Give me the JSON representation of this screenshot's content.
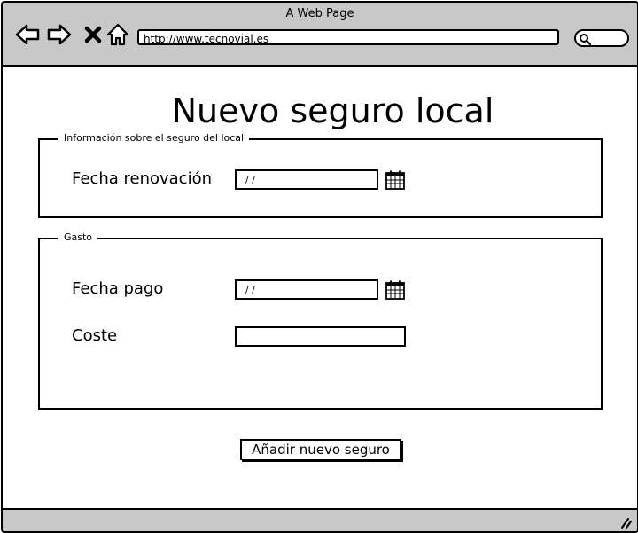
{
  "window": {
    "title": "A Web Page"
  },
  "browser": {
    "url": "http://www.tecnovial.es"
  },
  "page": {
    "title": "Nuevo seguro local"
  },
  "section_insurance": {
    "legend": "Información sobre el seguro del local",
    "renewal_label": "Fecha renovación",
    "renewal_value": "/ /"
  },
  "section_expense": {
    "legend": "Gasto",
    "payment_label": "Fecha pago",
    "payment_value": "/ /",
    "cost_label": "Coste",
    "cost_value": ""
  },
  "actions": {
    "submit_label": "Añadir nuevo seguro"
  },
  "icons": {
    "back": "back-arrow-icon",
    "forward": "forward-arrow-icon",
    "stop": "close-icon",
    "home": "home-icon",
    "search": "search-icon",
    "calendar": "calendar-icon",
    "resize": "resize-grip-icon"
  }
}
